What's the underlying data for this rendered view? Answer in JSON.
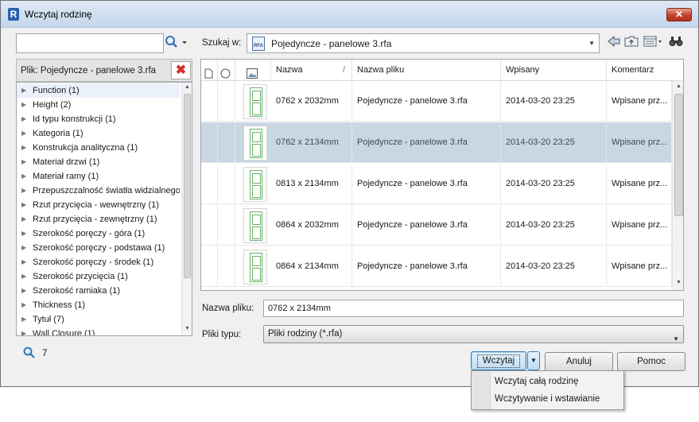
{
  "window": {
    "title": "Wczytaj rodzinę",
    "app_icon": "R",
    "close_label": "✕"
  },
  "left": {
    "search": {
      "value": "",
      "placeholder": ""
    },
    "filter_label": "Plik: Pojedyncze - panelowe 3.rfa",
    "tree_items": [
      "Function (1)",
      "Height (2)",
      "Id typu konstrukcji (1)",
      "Kategoria (1)",
      "Konstrukcja analityczna (1)",
      "Materiał drzwi (1)",
      "Materiał ramy (1)",
      "Przepuszczalność światła widzialnego",
      "Rzut przycięcia - wewnętrzny (1)",
      "Rzut przycięcia - zewnętrzny (1)",
      "Szerokość poręczy - góra (1)",
      "Szerokość poręczy - podstawa (1)",
      "Szerokość poręczy - środek (1)",
      "Szerokość przycięcia (1)",
      "Szerokość ramiaka (1)",
      "Thickness (1)",
      "Tytuł (7)",
      "Wall Closure (1)"
    ],
    "result_count": "7"
  },
  "lookin": {
    "label": "Szukaj w:",
    "value": "Pojedyncze - panelowe 3.rfa",
    "icon_text": "RFA"
  },
  "toolbar": {
    "icons": [
      "back-icon",
      "up-folder-icon",
      "views-icon",
      "find-icon"
    ]
  },
  "list": {
    "headers": {
      "name": "Nazwa",
      "sort_indicator": "/",
      "file": "Nazwa pliku",
      "date": "Wpisany",
      "comment": "Komentarz"
    },
    "rows": [
      {
        "name": "0762 x 2032mm",
        "file": "Pojedyncze - panelowe 3.rfa",
        "date": "2014-03-20 23:25",
        "comment": "Wpisane prz..."
      },
      {
        "name": "0762 x 2134mm",
        "file": "Pojedyncze - panelowe 3.rfa",
        "date": "2014-03-20 23:25",
        "comment": "Wpisane prz..."
      },
      {
        "name": "0813 x 2134mm",
        "file": "Pojedyncze - panelowe 3.rfa",
        "date": "2014-03-20 23:25",
        "comment": "Wpisane prz..."
      },
      {
        "name": "0864 x 2032mm",
        "file": "Pojedyncze - panelowe 3.rfa",
        "date": "2014-03-20 23:25",
        "comment": "Wpisane prz..."
      },
      {
        "name": "0864 x 2134mm",
        "file": "Pojedyncze - panelowe 3.rfa",
        "date": "2014-03-20 23:25",
        "comment": "Wpisane prz..."
      }
    ],
    "selected_index": 1
  },
  "filename": {
    "label": "Nazwa pliku:",
    "value": "0762 x 2134mm"
  },
  "filetype": {
    "label": "Pliki typu:",
    "value": "Pliki rodziny (*.rfa)"
  },
  "buttons": {
    "open": "Wczytaj",
    "cancel": "Anuluj",
    "help": "Pomoc"
  },
  "dropdown_menu": {
    "items": [
      "Wczytaj całą rodzinę",
      "Wczytywanie i wstawianie"
    ]
  },
  "colors": {
    "selection": "#c9d6e4",
    "close": "#c4412d",
    "door": "#6bb36b"
  }
}
